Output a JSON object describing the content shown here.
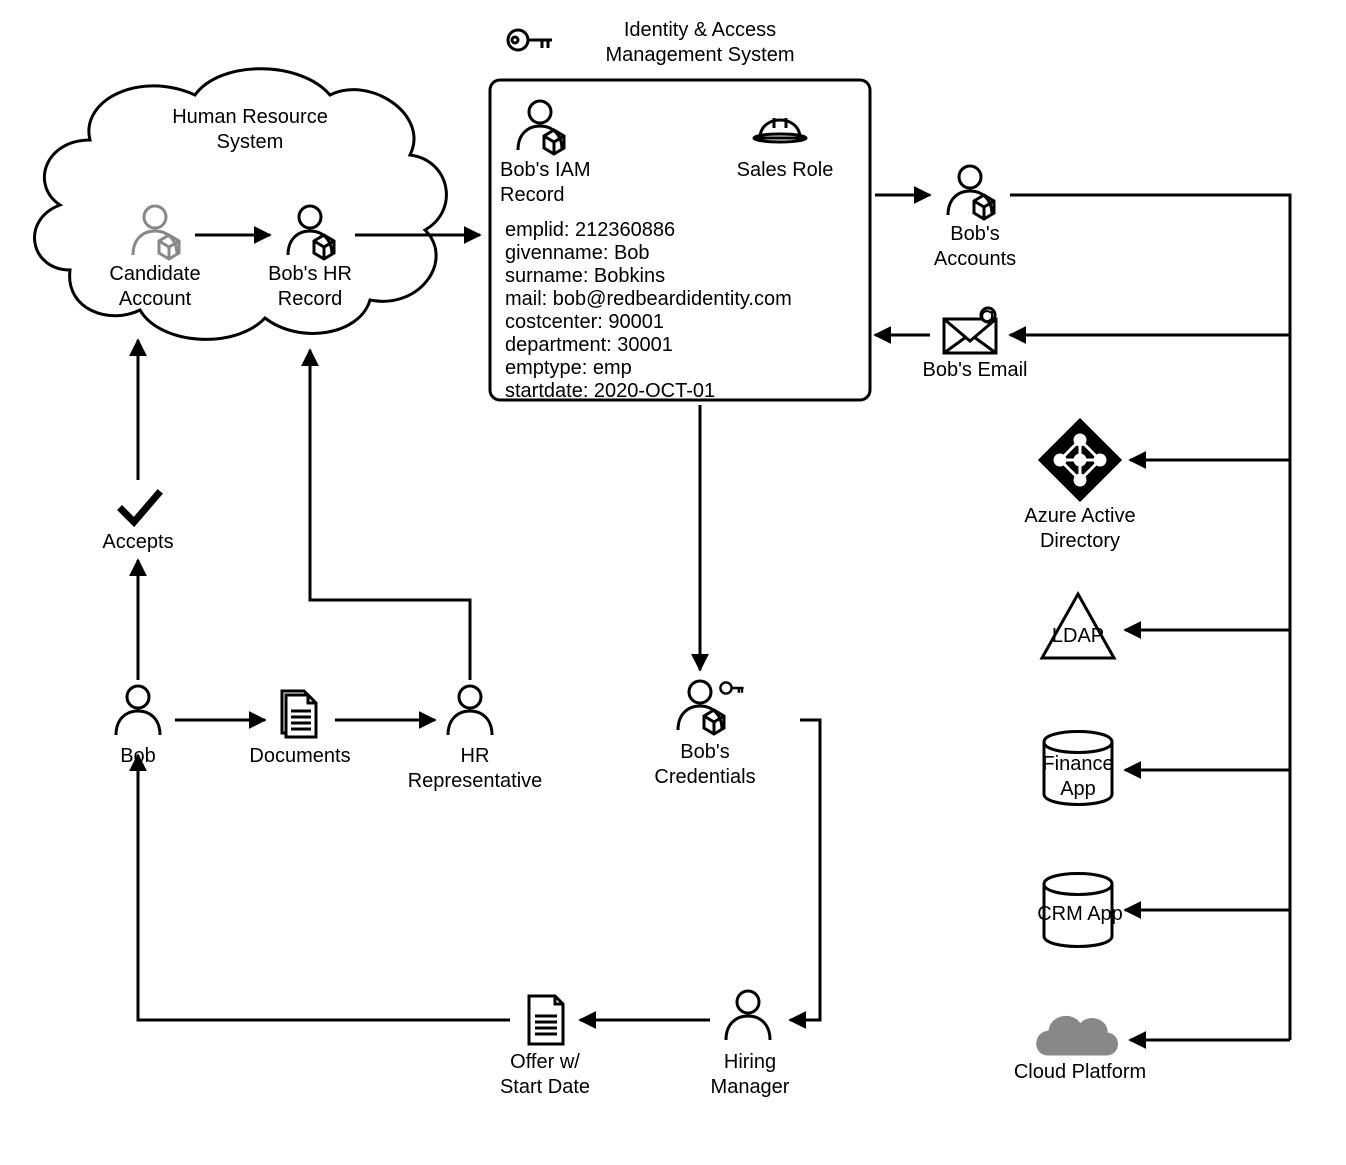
{
  "title": "Identity & Access\nManagement System",
  "hrSystem": {
    "title": "Human Resource\nSystem"
  },
  "flow": {
    "candidateAccount": "Candidate\nAccount",
    "hrRecord": "Bob's HR\nRecord",
    "accepts": "Accepts",
    "bob": "Bob",
    "documents": "Documents",
    "hrRep": "HR\nRepresentative",
    "credentials": "Bob's\nCredentials",
    "offer": "Offer w/\nStart Date",
    "hiringManager": "Hiring\nManager"
  },
  "iamBox": {
    "recordLabel": "Bob's IAM\nRecord",
    "salesRole": "Sales Role",
    "attributes": [
      "emplid: 212360886",
      "givenname: Bob",
      "surname: Bobkins",
      "mail: bob@redbeardidentity.com",
      "costcenter: 90001",
      "department: 30001",
      "emptype: emp",
      "startdate: 2020-OCT-01"
    ]
  },
  "right": {
    "accounts": "Bob's\nAccounts",
    "email": "Bob's Email",
    "aad": "Azure Active\nDirectory",
    "ldap": "LDAP",
    "finance": "Finance\nApp",
    "crm": "CRM App",
    "cloud": "Cloud Platform"
  }
}
